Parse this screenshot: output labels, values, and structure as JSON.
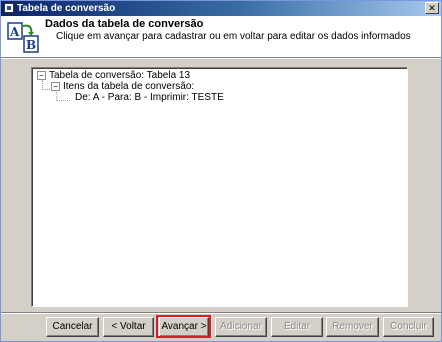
{
  "window": {
    "title": "Tabela de conversão"
  },
  "header": {
    "title": "Dados da tabela de conversão",
    "subtitle": "Clique em avançar para cadastrar ou em voltar para editar os dados informados",
    "logo": {
      "letter_top": "A",
      "letter_bottom": "B"
    }
  },
  "tree": {
    "root": "Tabela de conversão: Tabela 13",
    "child": "Itens da tabela de conversão:",
    "leaf": "De: A - Para: B - Imprimir: TESTE"
  },
  "buttons": {
    "cancel": "Cancelar",
    "back": "< Voltar",
    "next": "Avançar >",
    "add": "Adicionar",
    "edit": "Editar",
    "remove": "Remover",
    "finish": "Concluir"
  },
  "colors": {
    "highlight": "#e01b24",
    "titlebar": "#0a246a"
  }
}
